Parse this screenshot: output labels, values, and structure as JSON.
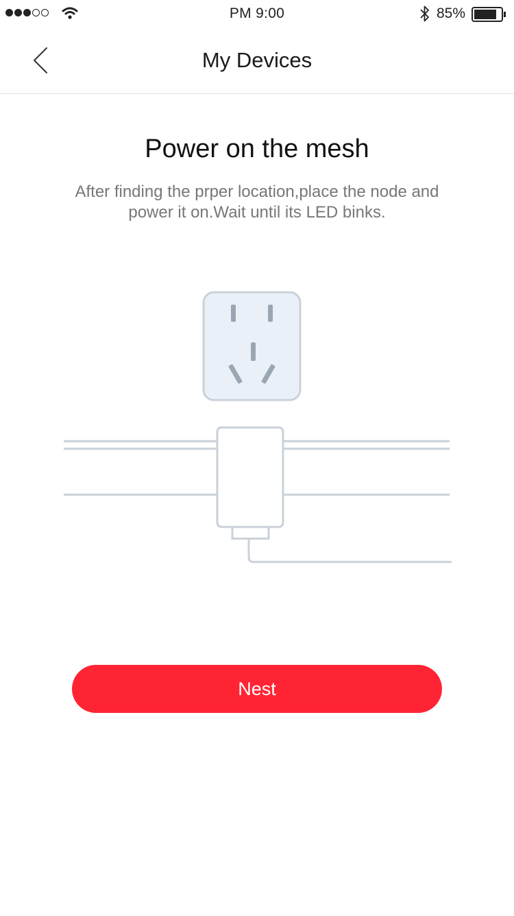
{
  "status_bar": {
    "time": "PM  9:00",
    "battery_percent": "85%",
    "signal_bars": 3,
    "signal_total": 5,
    "battery_level": 0.85
  },
  "nav": {
    "title": "My Devices",
    "back_icon": "chevron-left-icon"
  },
  "content": {
    "heading": "Power on the mesh",
    "description": "After finding the prper location,place the node and power it on.Wait until its LED binks."
  },
  "illustration": {
    "icons": [
      "power-outlet-icon",
      "mesh-node-icon"
    ],
    "stroke_color": "#c9d1da",
    "outlet_fill": "#eaf0f7",
    "slot_color": "#9aa6b2"
  },
  "actions": {
    "primary_label": "Nest",
    "primary_color": "#ff2434"
  }
}
